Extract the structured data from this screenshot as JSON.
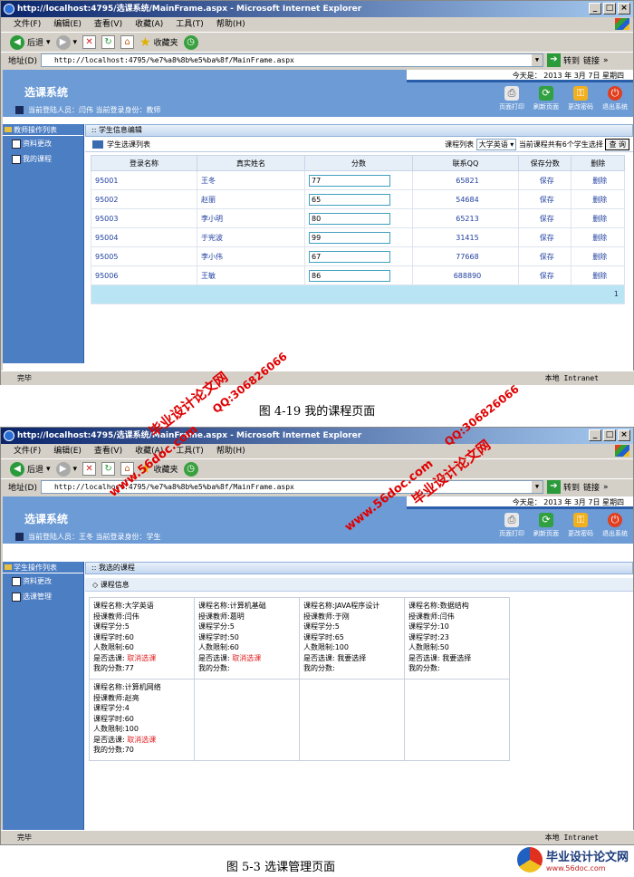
{
  "window1": {
    "title": "http://localhost:4795/选课系统/MainFrame.aspx - Microsoft Internet Explorer",
    "menu": [
      "文件(F)",
      "编辑(E)",
      "查看(V)",
      "收藏(A)",
      "工具(T)",
      "帮助(H)"
    ],
    "toolbar": {
      "back": "后退",
      "favorites": "收藏夹"
    },
    "address_label": "地址(D)",
    "address_value": "http://localhost:4795/%e7%a8%8b%e5%ba%8f/MainFrame.aspx",
    "go_label": "转到",
    "links_label": "链接",
    "app": {
      "title": "选课系统",
      "date": "今天是： 2013 年 3月 7日 星期四",
      "current_user": "当前登陆人员：闫伟 当前登录身份：教师",
      "header_icons": [
        "页面打印",
        "刷新页面",
        "更改密码",
        "退出系统"
      ]
    },
    "sidebar": {
      "head": "教师操作列表",
      "items": [
        "资料更改",
        "我的课程"
      ]
    },
    "main": {
      "section": "学生信息编辑",
      "list_title": "学生选课列表",
      "course_label": "课程列表",
      "course_selected": "大学英语",
      "count_text": "当前课程共有6个学生选择",
      "query_button": "查 询",
      "columns": [
        "登录名称",
        "真实姓名",
        "分数",
        "联系QQ",
        "保存分数",
        "删除"
      ],
      "rows": [
        {
          "login": "95001",
          "name": "王冬",
          "score": "77",
          "qq": "65821",
          "save": "保存",
          "del": "删除"
        },
        {
          "login": "95002",
          "name": "赵丽",
          "score": "65",
          "qq": "54684",
          "save": "保存",
          "del": "删除"
        },
        {
          "login": "95003",
          "name": "李小明",
          "score": "80",
          "qq": "65213",
          "save": "保存",
          "del": "删除"
        },
        {
          "login": "95004",
          "name": "于宪波",
          "score": "99",
          "qq": "31415",
          "save": "保存",
          "del": "删除"
        },
        {
          "login": "95005",
          "name": "李小伟",
          "score": "67",
          "qq": "77668",
          "save": "保存",
          "del": "删除"
        },
        {
          "login": "95006",
          "name": "王敏",
          "score": "86",
          "qq": "688890",
          "save": "保存",
          "del": "删除"
        }
      ],
      "page_number": "1"
    },
    "status": "完毕",
    "zone": "本地 Intranet"
  },
  "caption1": "图 4-19 我的课程页面",
  "window2": {
    "title": "http://localhost:4795/选课系统/MainFrame.aspx - Microsoft Internet Explorer",
    "menu": [
      "文件(F)",
      "编辑(E)",
      "查看(V)",
      "收藏(A)",
      "工具(T)",
      "帮助(H)"
    ],
    "toolbar": {
      "back": "后退",
      "favorites": "收藏夹"
    },
    "address_label": "地址(D)",
    "address_value": "http://localhost:4795/%e7%a8%8b%e5%ba%8f/MainFrame.aspx",
    "go_label": "转到",
    "links_label": "链接",
    "app": {
      "title": "选课系统",
      "date": "今天是： 2013 年 3月 7日 星期四",
      "current_user": "当前登陆人员：王冬 当前登录身份：学生",
      "header_icons": [
        "页面打印",
        "刷新页面",
        "更改密码",
        "退出系统"
      ]
    },
    "sidebar": {
      "head": "学生操作列表",
      "items": [
        "资料更改",
        "选课管理"
      ]
    },
    "main": {
      "section": "我选的课程",
      "sub": "课程信息",
      "courses": [
        {
          "name": "课程名称:大学英语",
          "teacher": "授课教师:闫伟",
          "credit": "课程学分:5",
          "hours": "课程学时:60",
          "limit": "人数限制:60",
          "chosen_label": "是否选课:",
          "chosen": "取消选课",
          "score": "我的分数:77",
          "cancel": true
        },
        {
          "name": "课程名称:计算机基础",
          "teacher": "授课教师:葛明",
          "credit": "课程学分:5",
          "hours": "课程学时:50",
          "limit": "人数限制:60",
          "chosen_label": "是否选课:",
          "chosen": "取消选课",
          "score": "我的分数:",
          "cancel": true
        },
        {
          "name": "课程名称:JAVA程序设计",
          "teacher": "授课教师:于刚",
          "credit": "课程学分:5",
          "hours": "课程学时:65",
          "limit": "人数限制:100",
          "chosen_label": "是否选课:",
          "chosen": "我要选择",
          "score": "我的分数:",
          "cancel": false
        },
        {
          "name": "课程名称:数据结构",
          "teacher": "授课教师:闫伟",
          "credit": "课程学分:10",
          "hours": "课程学时:23",
          "limit": "人数限制:50",
          "chosen_label": "是否选课:",
          "chosen": "我要选择",
          "score": "我的分数:",
          "cancel": false
        },
        {
          "name": "课程名称:计算机网络",
          "teacher": "授课教师:赵亮",
          "credit": "课程学分:4",
          "hours": "课程学时:60",
          "limit": "人数限制:100",
          "chosen_label": "是否选课:",
          "chosen": "取消选课",
          "score": "我的分数:70",
          "cancel": true
        }
      ]
    },
    "status": "完毕",
    "zone": "本地 Intranet"
  },
  "caption2": "图 5-3 选课管理页面",
  "watermarks": {
    "site_name": "毕业设计论文网",
    "qq": "QQ:306826066",
    "url": "www.56doc.com"
  },
  "footer_logo": {
    "name": "毕业设计论文网",
    "url": "www.56doc.com"
  }
}
